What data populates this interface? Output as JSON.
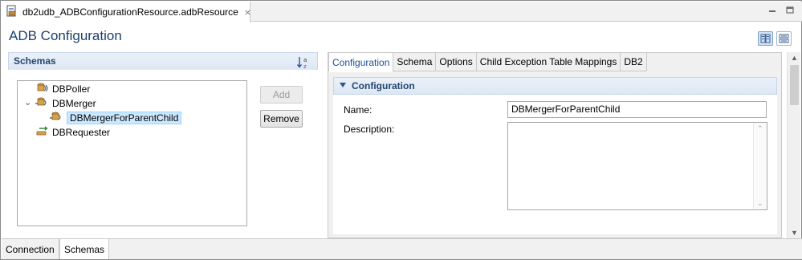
{
  "editor": {
    "tab_title": "db2udb_ADBConfigurationResource.adbResource",
    "close_glyph": "⨯"
  },
  "header": {
    "title": "ADB Configuration"
  },
  "schemas": {
    "title": "Schemas",
    "tree": [
      {
        "label": "DBPoller",
        "icon": "db-poller-icon"
      },
      {
        "label": "DBMerger",
        "icon": "db-merger-icon",
        "expanded": true
      },
      {
        "label": "DBMergerForParentChild",
        "icon": "db-merger-icon",
        "selected": true
      },
      {
        "label": "DBRequester",
        "icon": "db-requester-icon"
      }
    ],
    "add_label": "Add",
    "remove_label": "Remove"
  },
  "right": {
    "tabs": [
      "Configuration",
      "Schema",
      "Options",
      "Child Exception Table Mappings",
      "DB2"
    ],
    "active_tab": "Configuration",
    "section_title": "Configuration",
    "name_label": "Name:",
    "name_value": "DBMergerForParentChild",
    "description_label": "Description:",
    "description_value": ""
  },
  "bottom_tabs": [
    "Connection",
    "Schemas"
  ],
  "active_bottom_tab": "Schemas",
  "colors": {
    "title": "#1c3f6e",
    "section_header": "#24466f",
    "active_tab_text": "#1a4f9a",
    "selection": "#cce8ff"
  }
}
